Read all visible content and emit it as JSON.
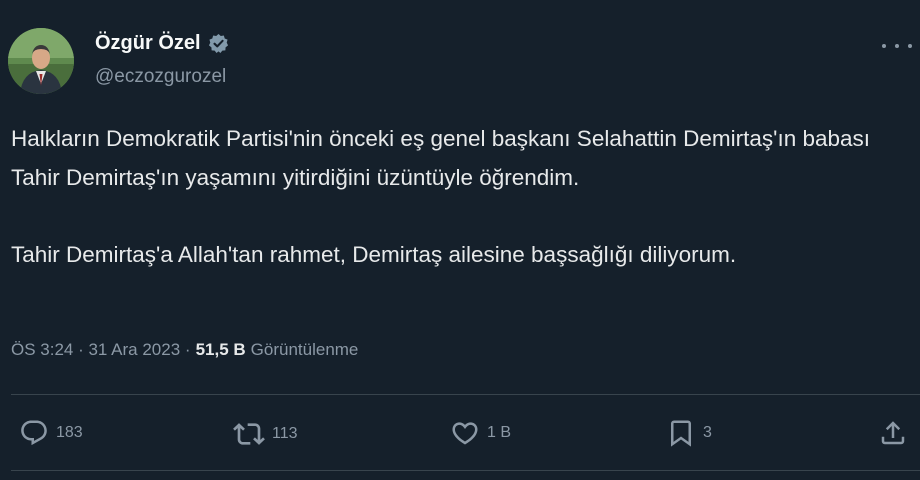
{
  "tweet": {
    "display_name": "Özgür Özel",
    "handle": "@eczozgurozel",
    "text": "Halkların Demokratik Partisi'nin önceki eş genel başkanı Selahattin Demirtaş'ın babası Tahir Demirtaş'ın yaşamını yitirdiğini üzüntüyle öğrendim.\n\nTahir Demirtaş'a Allah'tan rahmet, Demirtaş ailesine başsağlığı diliyorum.",
    "timestamp": "ÖS 3:24 · 31 Ara 2023 ·",
    "views_count": "51,5 B",
    "views_label": "Görüntülenme"
  },
  "actions": {
    "replies": "183",
    "retweets": "113",
    "likes": "1 B",
    "bookmarks": "3"
  },
  "icons": [
    "verified-icon",
    "more-icon",
    "reply-icon",
    "retweet-icon",
    "like-icon",
    "bookmark-icon",
    "share-icon"
  ],
  "colors": {
    "background": "#15202b",
    "text": "#e7e9ea",
    "secondary": "#8b98a5",
    "divider": "#38444d"
  }
}
